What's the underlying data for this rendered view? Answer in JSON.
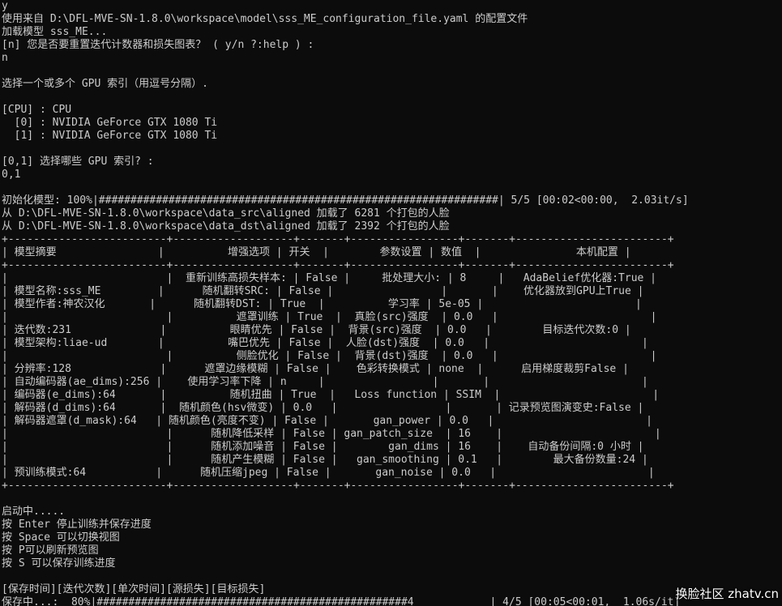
{
  "lines": [
    "y",
    "使用来自 D:\\DFL-MVE-SN-1.8.0\\workspace\\model\\sss_ME_configuration_file.yaml 的配置文件",
    "加载模型 sss_ME...",
    "[n] 您是否要重置迭代计数器和损失图表？ ( y/n ?:help ) :",
    "n",
    "",
    "选择一个或多个 GPU 索引（用逗号分隔）.",
    "",
    "[CPU] : CPU",
    "  [0] : NVIDIA GeForce GTX 1080 Ti",
    "  [1] : NVIDIA GeForce GTX 1080 Ti",
    "",
    "[0,1] 选择哪些 GPU 索引? :",
    "0,1",
    "",
    "初始化模型: 100%|###############################################################| 5/5 [00:02<00:00,  2.03it/s]",
    "从 D:\\DFL-MVE-SN-1.8.0\\workspace\\data_src\\aligned 加载了 6281 个打包的人脸",
    "从 D:\\DFL-MVE-SN-1.8.0\\workspace\\data_dst\\aligned 加载了 2392 个打包的人脸",
    "+-------------------------+-------------------+-------+-----------------+-------+------------------------+",
    "| 模型摘要                |          增强选项 | 开关  |        参数设置 | 数值  |               本机配置 |",
    "+-------------------------+-------------------+-------+-----------------+-------+------------------------+",
    "|                         |  重新训练高损失样本: | False |     批处理大小: | 8     |   AdaBelief优化器:True |",
    "| 模型名称:sss_ME         |      随机翻转SRC: | False |                 |       |    优化器放到GPU上True |",
    "| 模型作者:神农汉化       |      随机翻转DST: | True  |          学习率 | 5e-05 |                        |",
    "|                         |          遮罩训练 | True  |  真脸(src)强度  | 0.0   |                        |",
    "| 迭代数:231              |          眼睛优先 | False |  背景(src)强度  | 0.0   |        目标迭代次数:0 |",
    "| 模型架构:liae-ud        |          嘴巴优先 | False |  人脸(dst)强度  | 0.0   |                        |",
    "|                         |          侧脸优化 | False |  背景(dst)强度  | 0.0   |                        |",
    "| 分辨率:128              |      遮罩边缘模糊 | False |    色彩转换模式 | none  |      启用梯度裁剪False |",
    "| 自动编码器(ae_dims):256 |    使用学习率下降 | n     |                 |       |                        |",
    "| 编码器(e_dims):64       |          随机扭曲 | True  |   Loss function | SSIM  |                        |",
    "| 解码器(d_dims):64       |  随机颜色(hsv微变) | 0.0   |                 |       | 记录预览图演变史:False |",
    "| 解码器遮罩(d_mask):64   | 随机颜色(亮度不变) | False |       gan_power | 0.0   |                        |",
    "|                         |      随机降低采样 | False | gan_patch_size  | 16    |                        |",
    "|                         |      随机添加噪音 | False |        gan_dims | 16    |    自动备份间隔:0 小时 |",
    "|                         |      随机产生模糊 | False |   gan_smoothing | 0.1   |        最大备份数量:24 |",
    "| 预训练模式:64           |      随机压缩jpeg | False |       gan_noise | 0.0   |                        |",
    "+-------------------------+-------------------+-------+-----------------+-------+------------------------+",
    "",
    "启动中.....",
    "按 Enter 停止训练并保存进度",
    "按 Space 可以切换视图",
    "按 P可以刷新预览图",
    "按 S 可以保存训练进度",
    "",
    "[保存时间][迭代次数][单次时间][源损失][目标损失]",
    "保存中...:  80%|#################################################4            | 4/5 [00:05<00:01,  1.06s/it]"
  ],
  "watermark": "换脸社区 zhatv.cn"
}
